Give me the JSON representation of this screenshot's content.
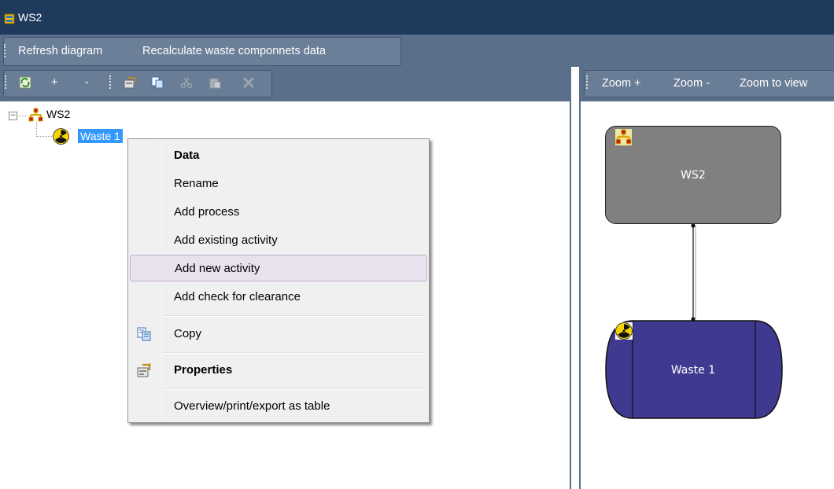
{
  "window": {
    "title": "WS2"
  },
  "menu": {
    "items": [
      {
        "label": "Refresh diagram"
      },
      {
        "label": "Recalculate waste componnets data"
      }
    ]
  },
  "left_toolbar": {
    "buttons": [
      {
        "icon": "refresh-icon"
      },
      {
        "label": "+"
      },
      {
        "label": "-"
      },
      {
        "icon": "properties-icon"
      },
      {
        "icon": "copy-icon"
      },
      {
        "icon": "cut-icon"
      },
      {
        "icon": "paste-icon"
      },
      {
        "icon": "delete-icon"
      }
    ]
  },
  "right_toolbar": {
    "buttons": [
      {
        "label": "Zoom +"
      },
      {
        "label": "Zoom -"
      },
      {
        "label": "Zoom to view"
      }
    ]
  },
  "tree": {
    "root": {
      "label": "WS2",
      "icon": "network-icon"
    },
    "child": {
      "label": "Waste 1",
      "icon": "radiation-icon",
      "selected": true
    }
  },
  "context_menu": {
    "items": [
      {
        "label": "Data",
        "bold": true
      },
      {
        "label": "Rename"
      },
      {
        "label": "Add process"
      },
      {
        "label": "Add existing activity"
      },
      {
        "label": "Add new activity",
        "highlighted": true
      },
      {
        "label": "Add check for clearance"
      },
      {
        "label": "Copy",
        "icon": "copy-icon"
      },
      {
        "label": "Properties",
        "bold": true,
        "icon": "properties-icon"
      },
      {
        "label": "Overview/print/export as table"
      }
    ]
  },
  "diagram": {
    "nodes": [
      {
        "label": "WS2",
        "icon": "network-icon",
        "color": "#808080"
      },
      {
        "label": "Waste 1",
        "icon": "radiation-icon",
        "color": "#3f3a8f"
      }
    ]
  },
  "colors": {
    "titlebar": "#1f3a5c",
    "menubar": "#5a6f8a",
    "selection": "#3399ff",
    "waste_node": "#3f3a8f",
    "ws2_node": "#808080"
  }
}
